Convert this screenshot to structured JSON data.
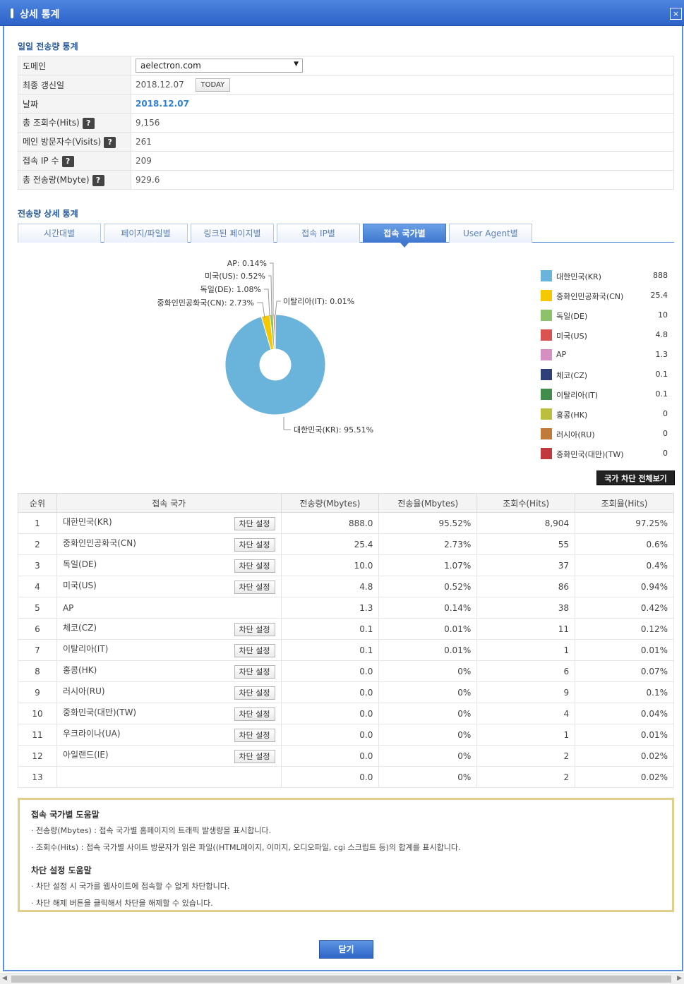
{
  "window": {
    "title": "상세 통계",
    "close_label": "×"
  },
  "daily": {
    "section_title": "일일 전송량 통계",
    "rows": {
      "domain": {
        "label": "도메인",
        "value": "aelectron.com"
      },
      "updated": {
        "label": "최종 갱신일",
        "value": "2018.12.07",
        "button": "TODAY"
      },
      "date": {
        "label": "날짜",
        "value": "2018.12.07"
      },
      "hits": {
        "label": "총 조회수(Hits)",
        "value": "9,156"
      },
      "visits": {
        "label": "메인 방문자수(Visits)",
        "value": "261"
      },
      "ips": {
        "label": "접속 IP 수",
        "value": "209"
      },
      "transfer": {
        "label": "총 전송량(Mbyte)",
        "value": "929.6"
      }
    },
    "help_icon": "?"
  },
  "detail": {
    "section_title": "전송량 상세 통계",
    "tabs": [
      "시간대별",
      "페이지/파일별",
      "링크된 페이지별",
      "접속 IP별",
      "접속 국가별",
      "User Agent별"
    ],
    "active_tab": "접속 국가별"
  },
  "chart_data": {
    "type": "pie",
    "donut": true,
    "slices": [
      {
        "label": "대한민국(KR)",
        "percent": 95.51,
        "color": "#6ab4dc"
      },
      {
        "label": "중화인민공화국(CN)",
        "percent": 2.73,
        "color": "#f5c800"
      },
      {
        "label": "독일(DE)",
        "percent": 1.08,
        "color": "#8cc26a"
      },
      {
        "label": "미국(US)",
        "percent": 0.52,
        "color": "#d9534f"
      },
      {
        "label": "AP",
        "percent": 0.14,
        "color": "#d68fc1"
      },
      {
        "label": "이탈리아(IT)",
        "percent": 0.01,
        "color": "#3f8c4c"
      }
    ],
    "slice_labels": [
      "대한민국(KR): 95.51%",
      "중화인민공화국(CN): 2.73%",
      "독일(DE): 1.08%",
      "미국(US): 0.52%",
      "AP: 0.14%",
      "이탈리아(IT): 0.01%"
    ],
    "legend": [
      {
        "name": "대한민국(KR)",
        "value": "888",
        "color": "#6ab4dc"
      },
      {
        "name": "중화인민공화국(CN)",
        "value": "25.4",
        "color": "#f5c800"
      },
      {
        "name": "독일(DE)",
        "value": "10",
        "color": "#8cc26a"
      },
      {
        "name": "미국(US)",
        "value": "4.8",
        "color": "#d9534f"
      },
      {
        "name": "AP",
        "value": "1.3",
        "color": "#d68fc1"
      },
      {
        "name": "체코(CZ)",
        "value": "0.1",
        "color": "#2e3f7a"
      },
      {
        "name": "이탈리아(IT)",
        "value": "0.1",
        "color": "#3f8c4c"
      },
      {
        "name": "홍콩(HK)",
        "value": "0",
        "color": "#bcbf3d"
      },
      {
        "name": "러시아(RU)",
        "value": "0",
        "color": "#c07a3a"
      },
      {
        "name": "중화민국(대만)(TW)",
        "value": "0",
        "color": "#c0393c"
      }
    ],
    "legend_placement": "right"
  },
  "block_all_label": "국가 차단 전체보기",
  "table": {
    "headers": [
      "순위",
      "접속 국가",
      "전송량(Mbytes)",
      "전송율(Mbytes)",
      "조회수(Hits)",
      "조회율(Hits)"
    ],
    "block_label": "차단 설정",
    "rows": [
      {
        "rank": "1",
        "country": "대한민국(KR)",
        "block": true,
        "mb": "888.0",
        "mbp": "95.52%",
        "hits": "8,904",
        "hp": "97.25%"
      },
      {
        "rank": "2",
        "country": "중화인민공화국(CN)",
        "block": true,
        "mb": "25.4",
        "mbp": "2.73%",
        "hits": "55",
        "hp": "0.6%"
      },
      {
        "rank": "3",
        "country": "독일(DE)",
        "block": true,
        "mb": "10.0",
        "mbp": "1.07%",
        "hits": "37",
        "hp": "0.4%"
      },
      {
        "rank": "4",
        "country": "미국(US)",
        "block": true,
        "mb": "4.8",
        "mbp": "0.52%",
        "hits": "86",
        "hp": "0.94%"
      },
      {
        "rank": "5",
        "country": "AP",
        "block": false,
        "mb": "1.3",
        "mbp": "0.14%",
        "hits": "38",
        "hp": "0.42%"
      },
      {
        "rank": "6",
        "country": "체코(CZ)",
        "block": true,
        "mb": "0.1",
        "mbp": "0.01%",
        "hits": "11",
        "hp": "0.12%"
      },
      {
        "rank": "7",
        "country": "이탈리아(IT)",
        "block": true,
        "mb": "0.1",
        "mbp": "0.01%",
        "hits": "1",
        "hp": "0.01%"
      },
      {
        "rank": "8",
        "country": "홍콩(HK)",
        "block": true,
        "mb": "0.0",
        "mbp": "0%",
        "hits": "6",
        "hp": "0.07%"
      },
      {
        "rank": "9",
        "country": "러시아(RU)",
        "block": true,
        "mb": "0.0",
        "mbp": "0%",
        "hits": "9",
        "hp": "0.1%"
      },
      {
        "rank": "10",
        "country": "중화민국(대만)(TW)",
        "block": true,
        "mb": "0.0",
        "mbp": "0%",
        "hits": "4",
        "hp": "0.04%"
      },
      {
        "rank": "11",
        "country": "우크라이나(UA)",
        "block": true,
        "mb": "0.0",
        "mbp": "0%",
        "hits": "1",
        "hp": "0.01%"
      },
      {
        "rank": "12",
        "country": "아일랜드(IE)",
        "block": true,
        "mb": "0.0",
        "mbp": "0%",
        "hits": "2",
        "hp": "0.02%"
      },
      {
        "rank": "13",
        "country": "",
        "block": false,
        "mb": "0.0",
        "mbp": "0%",
        "hits": "2",
        "hp": "0.02%"
      }
    ]
  },
  "help": {
    "country_title": "접속 국가별 도움말",
    "country_lines": [
      "· 전송량(Mbytes) : 접속 국가별 홈페이지의 트래픽 발생량을 표시합니다.",
      "· 조회수(Hits) : 접속 국가별 사이트 방문자가 읽은 파일((HTML페이지, 이미지, 오디오파일, cgi 스크립트 등)의 합계를 표시합니다."
    ],
    "block_title": "차단 설정 도움말",
    "block_lines": [
      "· 차단 설정 시 국가를 웹사이트에 접속할 수 없게 차단합니다.",
      "· 차단 해제 버튼을 클릭해서 차단을 해제할 수 있습니다."
    ]
  },
  "footer": {
    "close_label": "닫기"
  }
}
